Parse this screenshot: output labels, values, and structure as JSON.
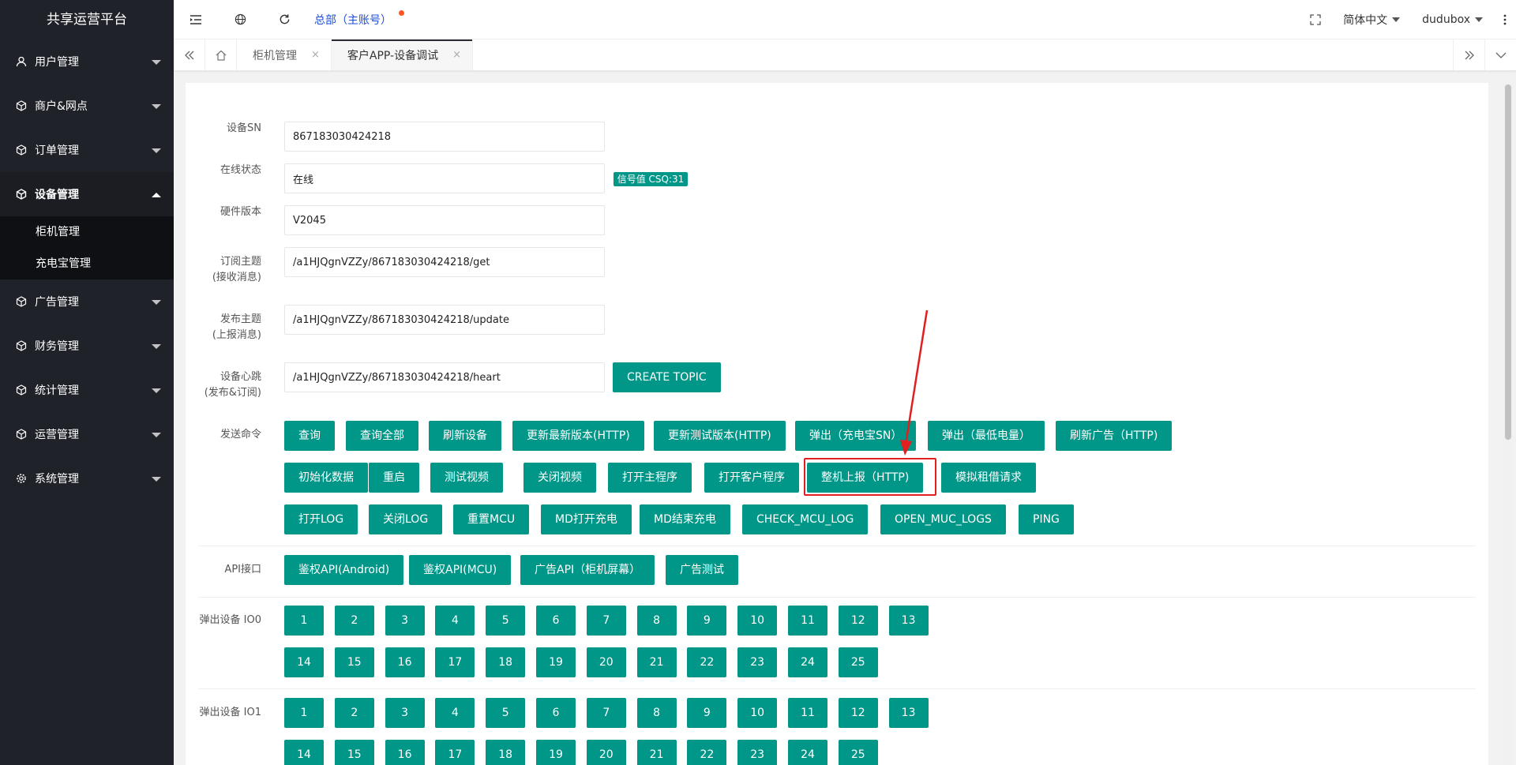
{
  "app": {
    "title": "共享运营平台"
  },
  "sidebar": {
    "items": [
      {
        "label": "用户管理",
        "icon": "user-icon"
      },
      {
        "label": "商户&网点",
        "icon": "cube-icon"
      },
      {
        "label": "订单管理",
        "icon": "cube-icon"
      },
      {
        "label": "设备管理",
        "icon": "cube-icon",
        "open": true
      },
      {
        "label": "广告管理",
        "icon": "cube-icon"
      },
      {
        "label": "财务管理",
        "icon": "cube-icon"
      },
      {
        "label": "统计管理",
        "icon": "cube-icon"
      },
      {
        "label": "运营管理",
        "icon": "cube-icon"
      },
      {
        "label": "系统管理",
        "icon": "gear-icon"
      }
    ],
    "sub_items": [
      "柜机管理",
      "充电宝管理"
    ]
  },
  "header": {
    "account": "总部（主账号）",
    "language": "简体中文",
    "user": "dudubox"
  },
  "tabs": [
    {
      "label": "柜机管理",
      "close": "×"
    },
    {
      "label": "客户APP-设备调试",
      "close": "×"
    }
  ],
  "form": {
    "sn": {
      "label": "设备SN",
      "value": "867183030424218"
    },
    "status": {
      "label": "在线状态",
      "value": "在线",
      "badge": "信号值 CSQ:31"
    },
    "hw": {
      "label": "硬件版本",
      "value": "V2045"
    },
    "sub_topic": {
      "label": "订阅主题",
      "label2": "(接收消息)",
      "value": "/a1HJQgnVZZy/867183030424218/get"
    },
    "pub_topic": {
      "label": "发布主题",
      "label2": "(上报消息)",
      "value": "/a1HJQgnVZZy/867183030424218/update"
    },
    "heart": {
      "label": "设备心跳",
      "label2": "(发布&订阅)",
      "value": "/a1HJQgnVZZy/867183030424218/heart",
      "button": "CREATE TOPIC"
    }
  },
  "commands": {
    "label": "发送命令",
    "row1": [
      "查询",
      "查询全部",
      "刷新设备",
      "更新最新版本(HTTP)",
      "更新测试版本(HTTP)",
      "弹出（充电宝SN）",
      "弹出（最低电量）",
      "刷新广告（HTTP)"
    ],
    "row2": [
      "初始化数据",
      "重启",
      "测试视频",
      "关闭视频",
      "打开主程序",
      "打开客户程序",
      "整机上报（HTTP)",
      "模拟租借请求"
    ],
    "row3": [
      "打开LOG",
      "关闭LOG",
      "重置MCU",
      "MD打开充电",
      "MD结束充电",
      "CHECK_MCU_LOG",
      "OPEN_MUC_LOGS",
      "PING"
    ]
  },
  "api": {
    "label": "API接口",
    "buttons": [
      "鉴权API(Android)",
      "鉴权API(MCU)",
      "广告API（柜机屏幕）",
      "广告测试"
    ]
  },
  "eject0": {
    "label": "弹出设备 IO0",
    "row1": [
      "1",
      "2",
      "3",
      "4",
      "5",
      "6",
      "7",
      "8",
      "9",
      "10",
      "11",
      "12",
      "13"
    ],
    "row2": [
      "14",
      "15",
      "16",
      "17",
      "18",
      "19",
      "20",
      "21",
      "22",
      "23",
      "24",
      "25"
    ]
  },
  "eject1": {
    "label": "弹出设备 IO1",
    "row1": [
      "1",
      "2",
      "3",
      "4",
      "5",
      "6",
      "7",
      "8",
      "9",
      "10",
      "11",
      "12",
      "13"
    ],
    "row2": [
      "14",
      "15",
      "16",
      "17",
      "18",
      "19",
      "20",
      "21",
      "22",
      "23",
      "24",
      "25"
    ]
  },
  "colors": {
    "primary": "#009688",
    "sidebar": "#20222a",
    "highlight": "#e02020"
  }
}
